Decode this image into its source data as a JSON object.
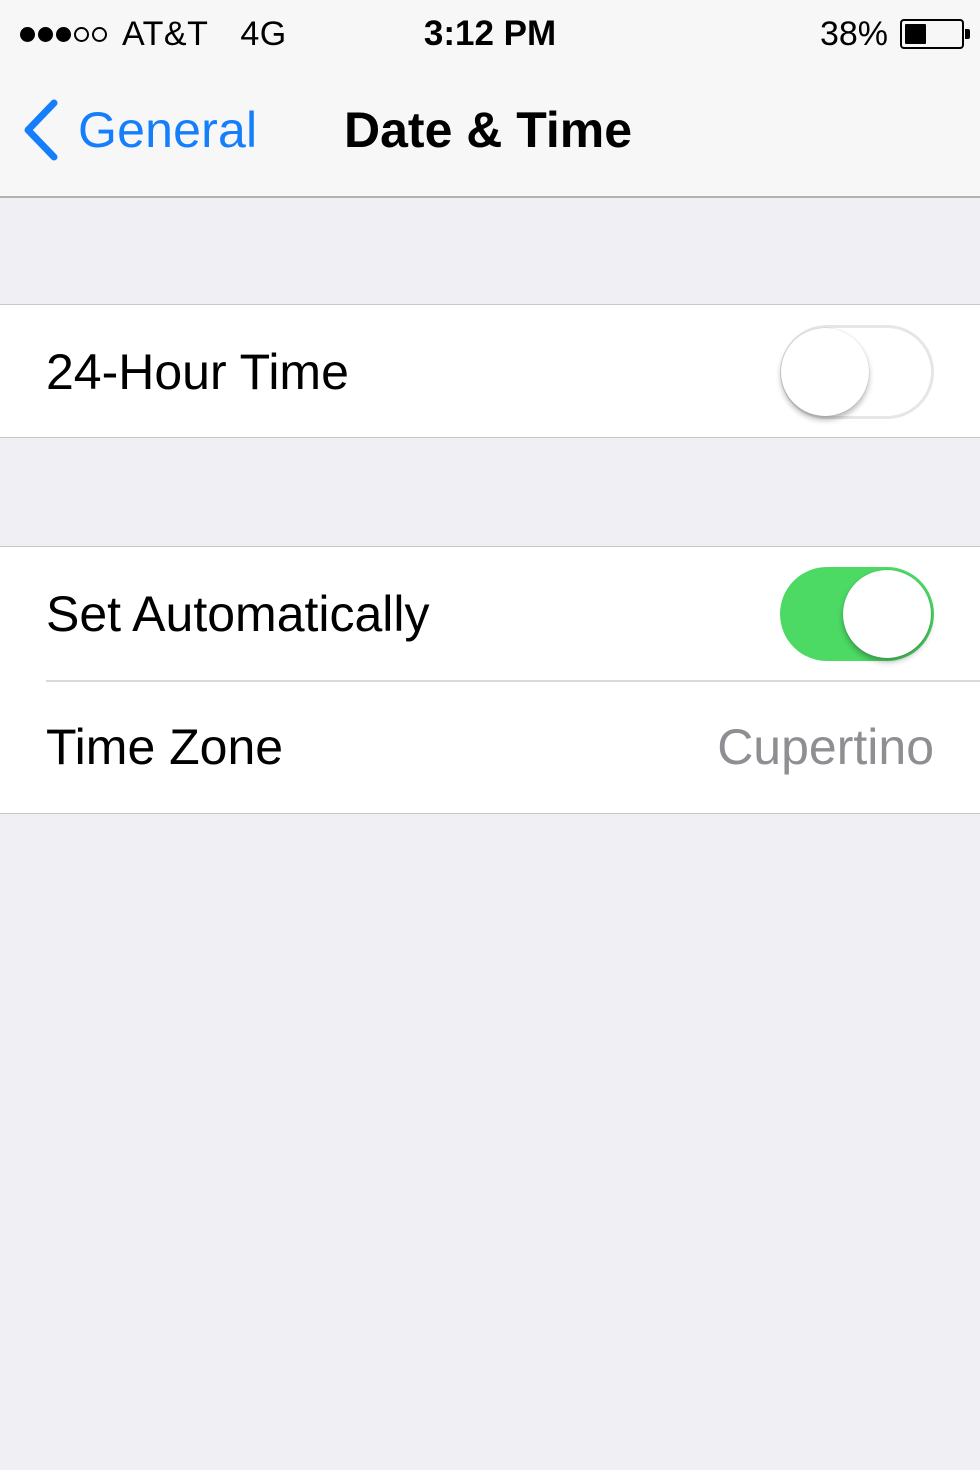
{
  "status_bar": {
    "signal_bars": {
      "filled": 3,
      "total": 5
    },
    "carrier": "AT&T",
    "network": "4G",
    "time": "3:12 PM",
    "battery_percent": "38%",
    "battery_level": 0.38
  },
  "nav": {
    "back_label": "General",
    "title": "Date & Time"
  },
  "settings": {
    "hour24": {
      "label": "24-Hour Time",
      "on": false
    },
    "set_automatically": {
      "label": "Set Automatically",
      "on": true
    },
    "time_zone": {
      "label": "Time Zone",
      "value": "Cupertino"
    }
  },
  "colors": {
    "accent_blue": "#157efb",
    "switch_on_green": "#4cd964",
    "background": "#efeff4"
  },
  "icons": {
    "back": "chevron-left-icon",
    "battery": "battery-icon",
    "signal": "signal-dots-icon"
  }
}
